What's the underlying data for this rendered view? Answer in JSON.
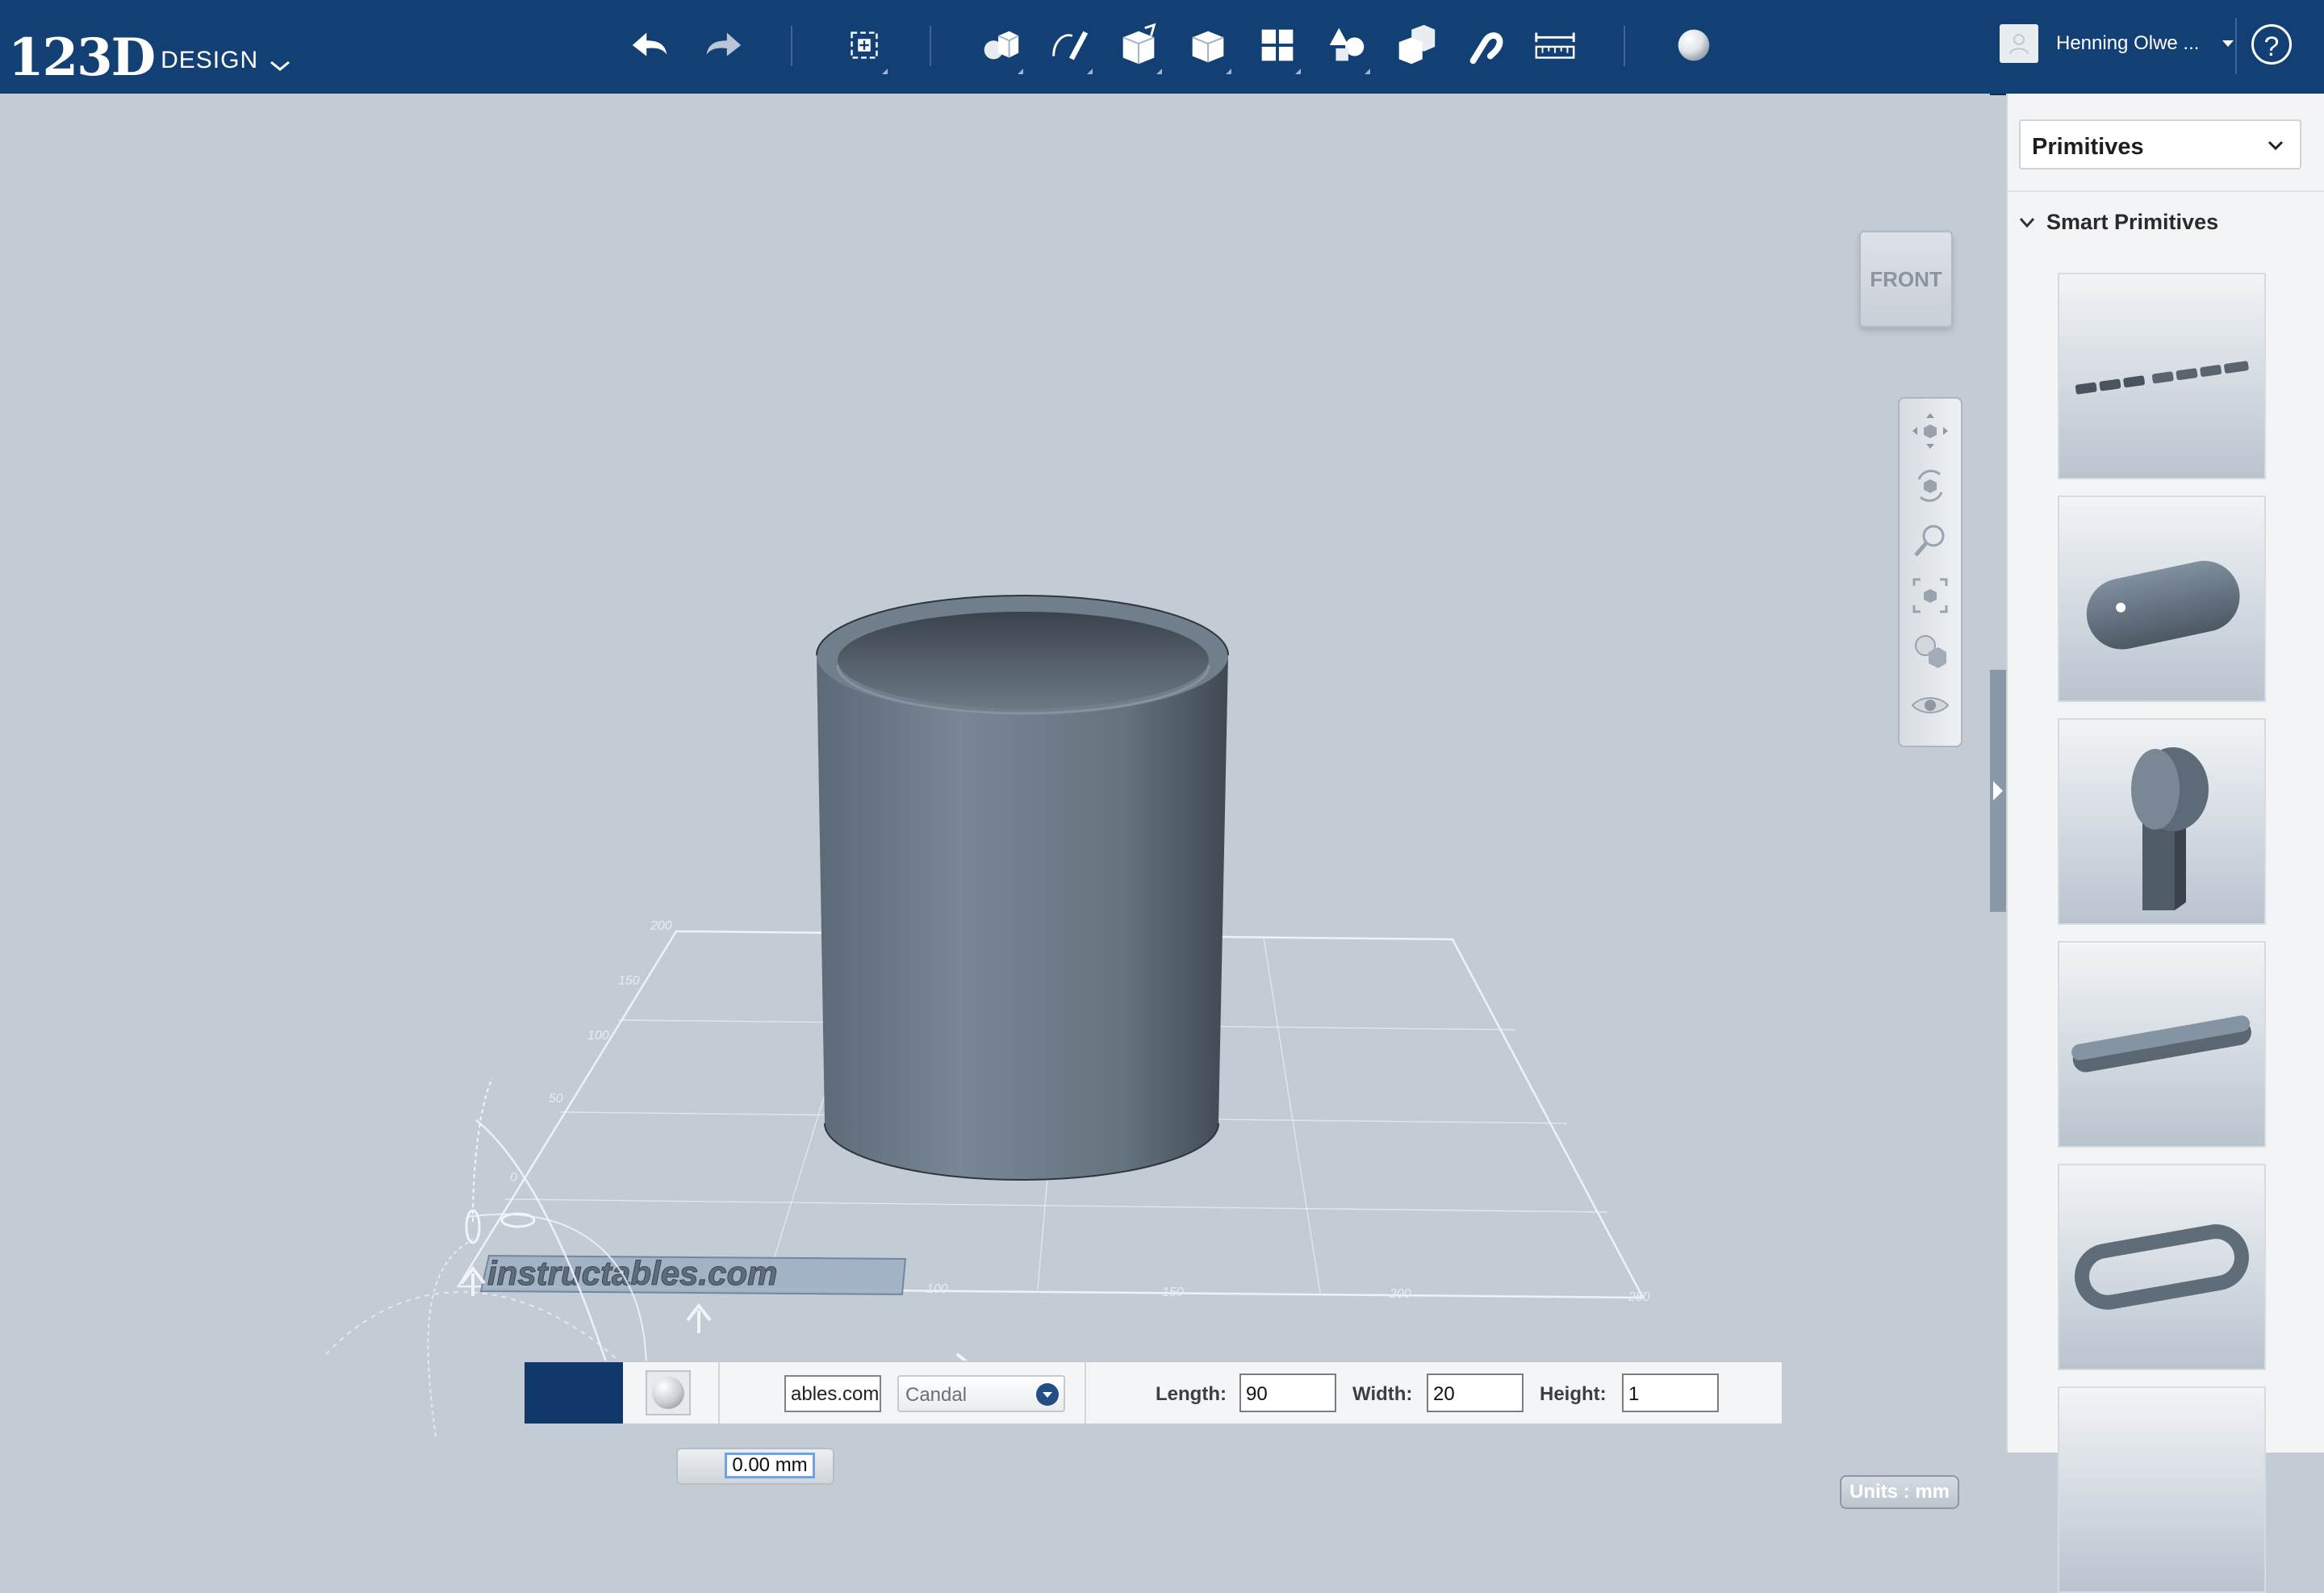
{
  "app": {
    "logo_number": "123D",
    "logo_word": "DESIGN"
  },
  "toolbar": {
    "items": [
      "undo-icon",
      "redo-icon",
      "transform-icon",
      "primitives-icon",
      "sketch-icon",
      "construct-icon",
      "modify-icon",
      "pattern-icon",
      "grouping-icon",
      "combine-icon",
      "snap-icon",
      "measure-icon",
      "material-icon"
    ]
  },
  "user": {
    "name": "Henning Olwe ...",
    "help": "?"
  },
  "viewcube": {
    "face": "FRONT"
  },
  "scene": {
    "grid_labels": [
      "200",
      "150",
      "100",
      "50",
      "0",
      "50",
      "100",
      "150",
      "200",
      "250"
    ],
    "text_object": "instructables.com"
  },
  "panel": {
    "category": "Primitives",
    "section": "Smart Primitives",
    "items": [
      "text-primitive",
      "capsule-primitive",
      "keyhole-primitive",
      "slot-primitive",
      "ring-slot-primitive",
      "more-primitive"
    ]
  },
  "properties": {
    "slider_value": "0.00 mm",
    "text_value": "ables.com",
    "font": "Candal",
    "length_label": "Length:",
    "length": "90",
    "width_label": "Width:",
    "width": "20",
    "height_label": "Height:",
    "height": "1"
  },
  "status": {
    "units": "Units : mm"
  },
  "colors": {
    "toolbar_bg": "#123f74",
    "viewport_bg": "#c3cbd4",
    "panel_bg": "#f3f4f6",
    "object": "#6f7e8c"
  }
}
